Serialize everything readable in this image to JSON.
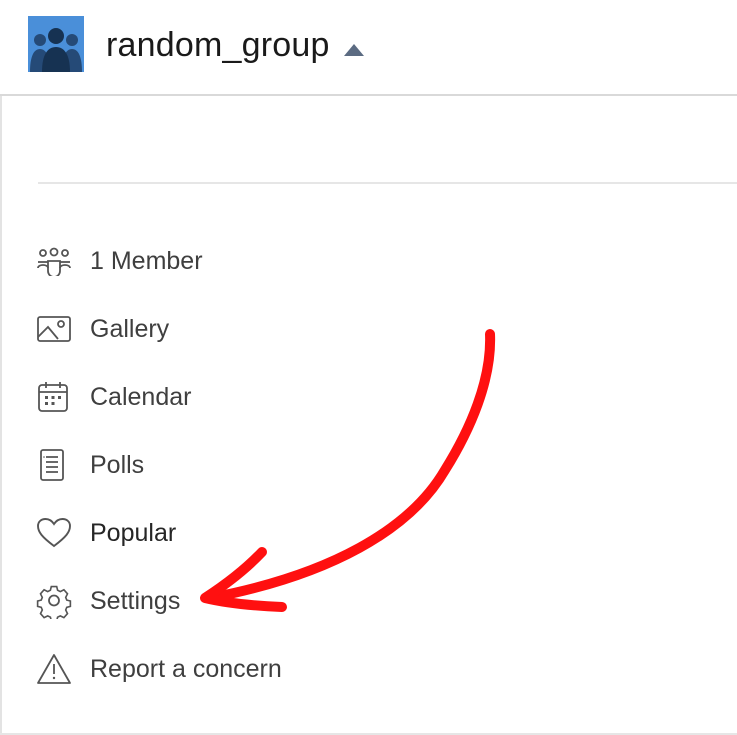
{
  "header": {
    "group_name": "random_group",
    "avatar_icon": "group-people-icon",
    "caret_icon": "caret-up-icon",
    "avatar_color": "#4a8fd9"
  },
  "menu": {
    "items": [
      {
        "label": "1 Member",
        "icon": "members-icon"
      },
      {
        "label": "Gallery",
        "icon": "gallery-icon"
      },
      {
        "label": "Calendar",
        "icon": "calendar-icon"
      },
      {
        "label": "Polls",
        "icon": "polls-icon"
      },
      {
        "label": "Popular",
        "icon": "heart-icon"
      },
      {
        "label": "Settings",
        "icon": "gear-icon"
      },
      {
        "label": "Report a concern",
        "icon": "warning-icon"
      }
    ]
  },
  "annotation": {
    "type": "red-arrow",
    "color": "#ff1010",
    "points_to": "Settings"
  }
}
